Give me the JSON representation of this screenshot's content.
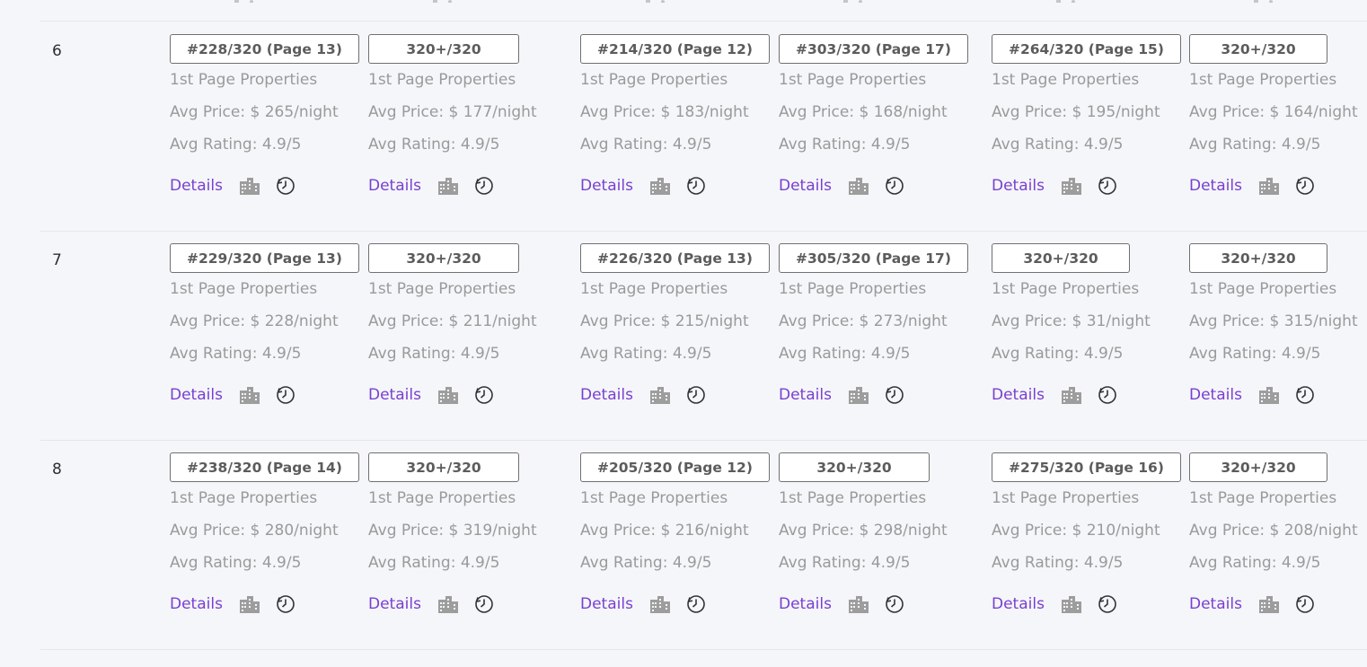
{
  "rows": [
    {
      "number": "6",
      "cells": [
        {
          "rank": "#228/320 (Page 13)",
          "first_page": "1st Page Properties",
          "avg_price": "Avg Price: $ 265/night",
          "avg_rating": "Avg Rating: 4.9/5",
          "details": "Details"
        },
        {
          "rank": "320+/320",
          "first_page": "1st Page Properties",
          "avg_price": "Avg Price: $ 177/night",
          "avg_rating": "Avg Rating: 4.9/5",
          "details": "Details"
        },
        {
          "rank": "#214/320 (Page 12)",
          "first_page": "1st Page Properties",
          "avg_price": "Avg Price: $ 183/night",
          "avg_rating": "Avg Rating: 4.9/5",
          "details": "Details"
        },
        {
          "rank": "#303/320 (Page 17)",
          "first_page": "1st Page Properties",
          "avg_price": "Avg Price: $ 168/night",
          "avg_rating": "Avg Rating: 4.9/5",
          "details": "Details"
        },
        {
          "rank": "#264/320 (Page 15)",
          "first_page": "1st Page Properties",
          "avg_price": "Avg Price: $ 195/night",
          "avg_rating": "Avg Rating: 4.9/5",
          "details": "Details"
        },
        {
          "rank": "320+/320",
          "first_page": "1st Page Properties",
          "avg_price": "Avg Price: $ 164/night",
          "avg_rating": "Avg Rating: 4.9/5",
          "details": "Details"
        }
      ]
    },
    {
      "number": "7",
      "cells": [
        {
          "rank": "#229/320 (Page 13)",
          "first_page": "1st Page Properties",
          "avg_price": "Avg Price: $ 228/night",
          "avg_rating": "Avg Rating: 4.9/5",
          "details": "Details"
        },
        {
          "rank": "320+/320",
          "first_page": "1st Page Properties",
          "avg_price": "Avg Price: $ 211/night",
          "avg_rating": "Avg Rating: 4.9/5",
          "details": "Details"
        },
        {
          "rank": "#226/320 (Page 13)",
          "first_page": "1st Page Properties",
          "avg_price": "Avg Price: $ 215/night",
          "avg_rating": "Avg Rating: 4.9/5",
          "details": "Details"
        },
        {
          "rank": "#305/320 (Page 17)",
          "first_page": "1st Page Properties",
          "avg_price": "Avg Price: $ 273/night",
          "avg_rating": "Avg Rating: 4.9/5",
          "details": "Details"
        },
        {
          "rank": "320+/320",
          "first_page": "1st Page Properties",
          "avg_price": "Avg Price: $ 31/night",
          "avg_rating": "Avg Rating: 4.9/5",
          "details": "Details"
        },
        {
          "rank": "320+/320",
          "first_page": "1st Page Properties",
          "avg_price": "Avg Price: $ 315/night",
          "avg_rating": "Avg Rating: 4.9/5",
          "details": "Details"
        }
      ]
    },
    {
      "number": "8",
      "cells": [
        {
          "rank": "#238/320 (Page 14)",
          "first_page": "1st Page Properties",
          "avg_price": "Avg Price: $ 280/night",
          "avg_rating": "Avg Rating: 4.9/5",
          "details": "Details"
        },
        {
          "rank": "320+/320",
          "first_page": "1st Page Properties",
          "avg_price": "Avg Price: $ 319/night",
          "avg_rating": "Avg Rating: 4.9/5",
          "details": "Details"
        },
        {
          "rank": "#205/320 (Page 12)",
          "first_page": "1st Page Properties",
          "avg_price": "Avg Price: $ 216/night",
          "avg_rating": "Avg Rating: 4.9/5",
          "details": "Details"
        },
        {
          "rank": "320+/320",
          "first_page": "1st Page Properties",
          "avg_price": "Avg Price: $ 298/night",
          "avg_rating": "Avg Rating: 4.9/5",
          "details": "Details"
        },
        {
          "rank": "#275/320 (Page 16)",
          "first_page": "1st Page Properties",
          "avg_price": "Avg Price: $ 210/night",
          "avg_rating": "Avg Rating: 4.9/5",
          "details": "Details"
        },
        {
          "rank": "320+/320",
          "first_page": "1st Page Properties",
          "avg_price": "Avg Price: $ 208/night",
          "avg_rating": "Avg Rating: 4.9/5",
          "details": "Details"
        }
      ]
    }
  ],
  "icons": {
    "building": "building-icon",
    "history": "history-clock-icon"
  },
  "colors": {
    "link": "#7a3fd1",
    "muted_text": "#9a9a9a",
    "background": "#f4f6f9",
    "badge_border": "#707070"
  }
}
